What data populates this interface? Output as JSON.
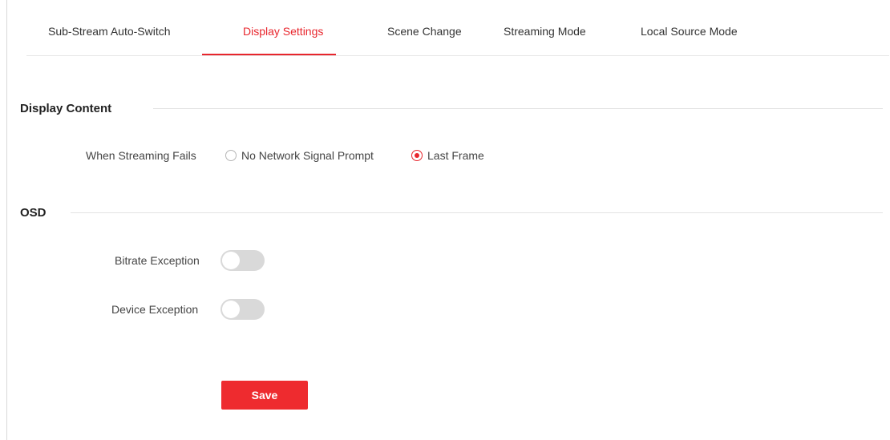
{
  "tabs": [
    {
      "label": "Sub-Stream Auto-Switch",
      "active": false
    },
    {
      "label": "Display Settings",
      "active": true
    },
    {
      "label": "Scene Change",
      "active": false
    },
    {
      "label": "Streaming Mode",
      "active": false
    },
    {
      "label": "Local Source Mode",
      "active": false
    }
  ],
  "display_content": {
    "title": "Display Content",
    "when_streaming_fails": {
      "label": "When Streaming Fails",
      "options": [
        {
          "label": "No Network Signal Prompt",
          "selected": false
        },
        {
          "label": "Last Frame",
          "selected": true
        }
      ]
    }
  },
  "osd": {
    "title": "OSD",
    "bitrate_exception": {
      "label": "Bitrate Exception",
      "enabled": false
    },
    "device_exception": {
      "label": "Device Exception",
      "enabled": false
    }
  },
  "save_label": "Save",
  "colors": {
    "accent": "#e8262d",
    "save_button": "#ee2b2f",
    "toggle_off": "#d9d9d9"
  }
}
